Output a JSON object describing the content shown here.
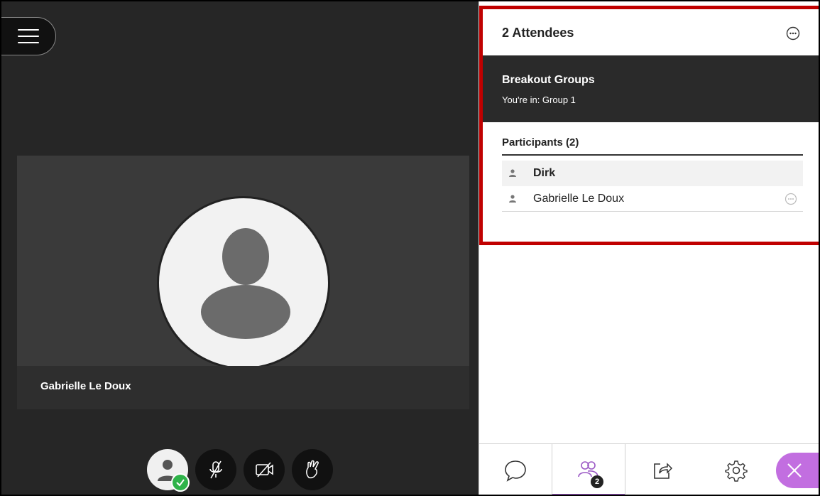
{
  "stage": {
    "menu_icon": "hamburger-menu-icon",
    "tile_name": "Gabrielle Le Doux"
  },
  "controls": [
    {
      "name": "my-status-button",
      "icon": "avatar-with-check-icon"
    },
    {
      "name": "mic-off-button",
      "icon": "microphone-muted-icon"
    },
    {
      "name": "camera-off-button",
      "icon": "camera-off-icon"
    },
    {
      "name": "hand-raise-button",
      "icon": "hand-icon"
    }
  ],
  "panel": {
    "title": "2 Attendees",
    "more_icon": "ellipsis-circle-icon",
    "breakout": {
      "heading": "Breakout Groups",
      "status": "You're in: Group 1"
    },
    "participants_header": "Participants (2)",
    "participants": [
      {
        "name": "Dirk"
      },
      {
        "name": "Gabrielle Le Doux"
      }
    ]
  },
  "tabs": [
    {
      "id": "chat",
      "icon": "chat-bubble-icon"
    },
    {
      "id": "attendees",
      "icon": "people-icon",
      "badge": "2",
      "active": true
    },
    {
      "id": "share",
      "icon": "share-content-icon"
    },
    {
      "id": "settings",
      "icon": "gear-icon"
    },
    {
      "id": "close",
      "icon": "close-icon"
    }
  ],
  "colors": {
    "accent": "#9b59c5",
    "close_pill": "#c26ee0",
    "status_ok": "#2fb34a",
    "highlight": "#c00000"
  }
}
